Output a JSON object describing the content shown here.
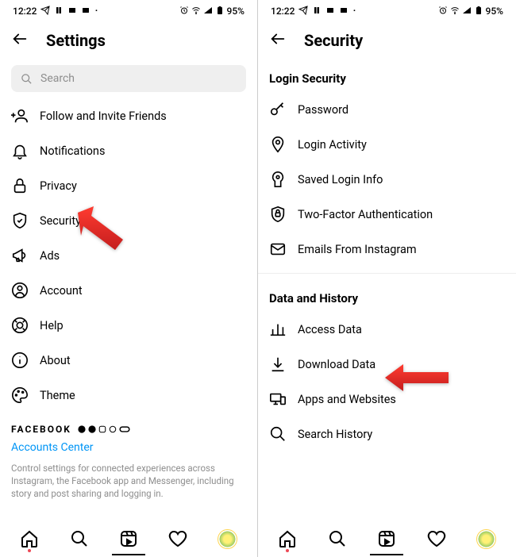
{
  "status": {
    "time": "12:22",
    "battery": "95%"
  },
  "left": {
    "title": "Settings",
    "search_placeholder": "Search",
    "items": [
      {
        "label": "Follow and Invite Friends"
      },
      {
        "label": "Notifications"
      },
      {
        "label": "Privacy"
      },
      {
        "label": "Security"
      },
      {
        "label": "Ads"
      },
      {
        "label": "Account"
      },
      {
        "label": "Help"
      },
      {
        "label": "About"
      },
      {
        "label": "Theme"
      }
    ],
    "brand": "FACEBOOK",
    "accounts_center": "Accounts Center",
    "footer_desc": "Control settings for connected experiences across Instagram, the Facebook app and Messenger, including story and post sharing and logging in."
  },
  "right": {
    "title": "Security",
    "section1": "Login Security",
    "items1": [
      {
        "label": "Password"
      },
      {
        "label": "Login Activity"
      },
      {
        "label": "Saved Login Info"
      },
      {
        "label": "Two-Factor Authentication"
      },
      {
        "label": "Emails From Instagram"
      }
    ],
    "section2": "Data and History",
    "items2": [
      {
        "label": "Access Data"
      },
      {
        "label": "Download Data"
      },
      {
        "label": "Apps and Websites"
      },
      {
        "label": "Search History"
      }
    ]
  }
}
